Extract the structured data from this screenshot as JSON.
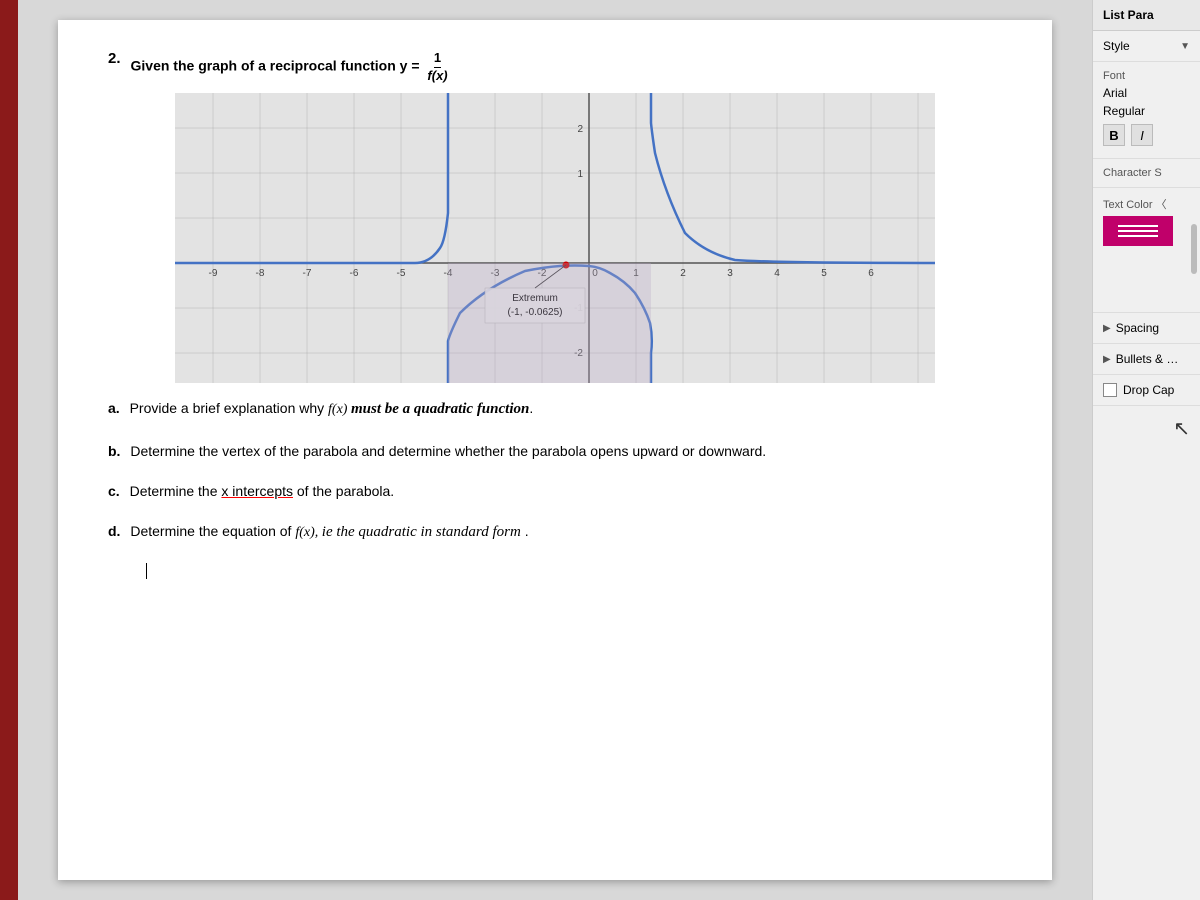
{
  "sidebar": {
    "header": "List Para",
    "style_label": "Style",
    "font_section": "Font",
    "font_name": "Arial",
    "font_style": "Regular",
    "bold_label": "B",
    "italic_label": "I",
    "character_label": "Character S",
    "text_color_label": "Text Color 〈",
    "spacing_label": "Spacing",
    "bullets_label": "Bullets & …",
    "drop_cap_label": "Drop Cap"
  },
  "document": {
    "question_number": "2.",
    "question_prefix": "Given the graph of a reciprocal function",
    "function_var": "y =",
    "fraction_num": "1",
    "fraction_den": "f(x)",
    "graph": {
      "x_min": -9,
      "x_max": 7,
      "y_min": -3.5,
      "y_max": 2.5,
      "extremum_label": "Extremum",
      "extremum_coords": "(-1, -0.0625)"
    },
    "sub_questions": [
      {
        "label": "a.",
        "text_normal": "Provide a brief explanation why",
        "text_math": "f(x)",
        "text_italic_bold": "must be a quadratic function",
        "text_end": "."
      },
      {
        "label": "b.",
        "text": "Determine the vertex of the parabola and determine whether the parabola opens upward or downward."
      },
      {
        "label": "c.",
        "text_start": "Determine the",
        "text_underline": "x intercepts",
        "text_end": "of the parabola."
      },
      {
        "label": "d.",
        "text_start": "Determine the equation of",
        "text_math": "f(x),",
        "text_italic": "ie the quadratic in standard form",
        "text_end": "."
      }
    ]
  }
}
